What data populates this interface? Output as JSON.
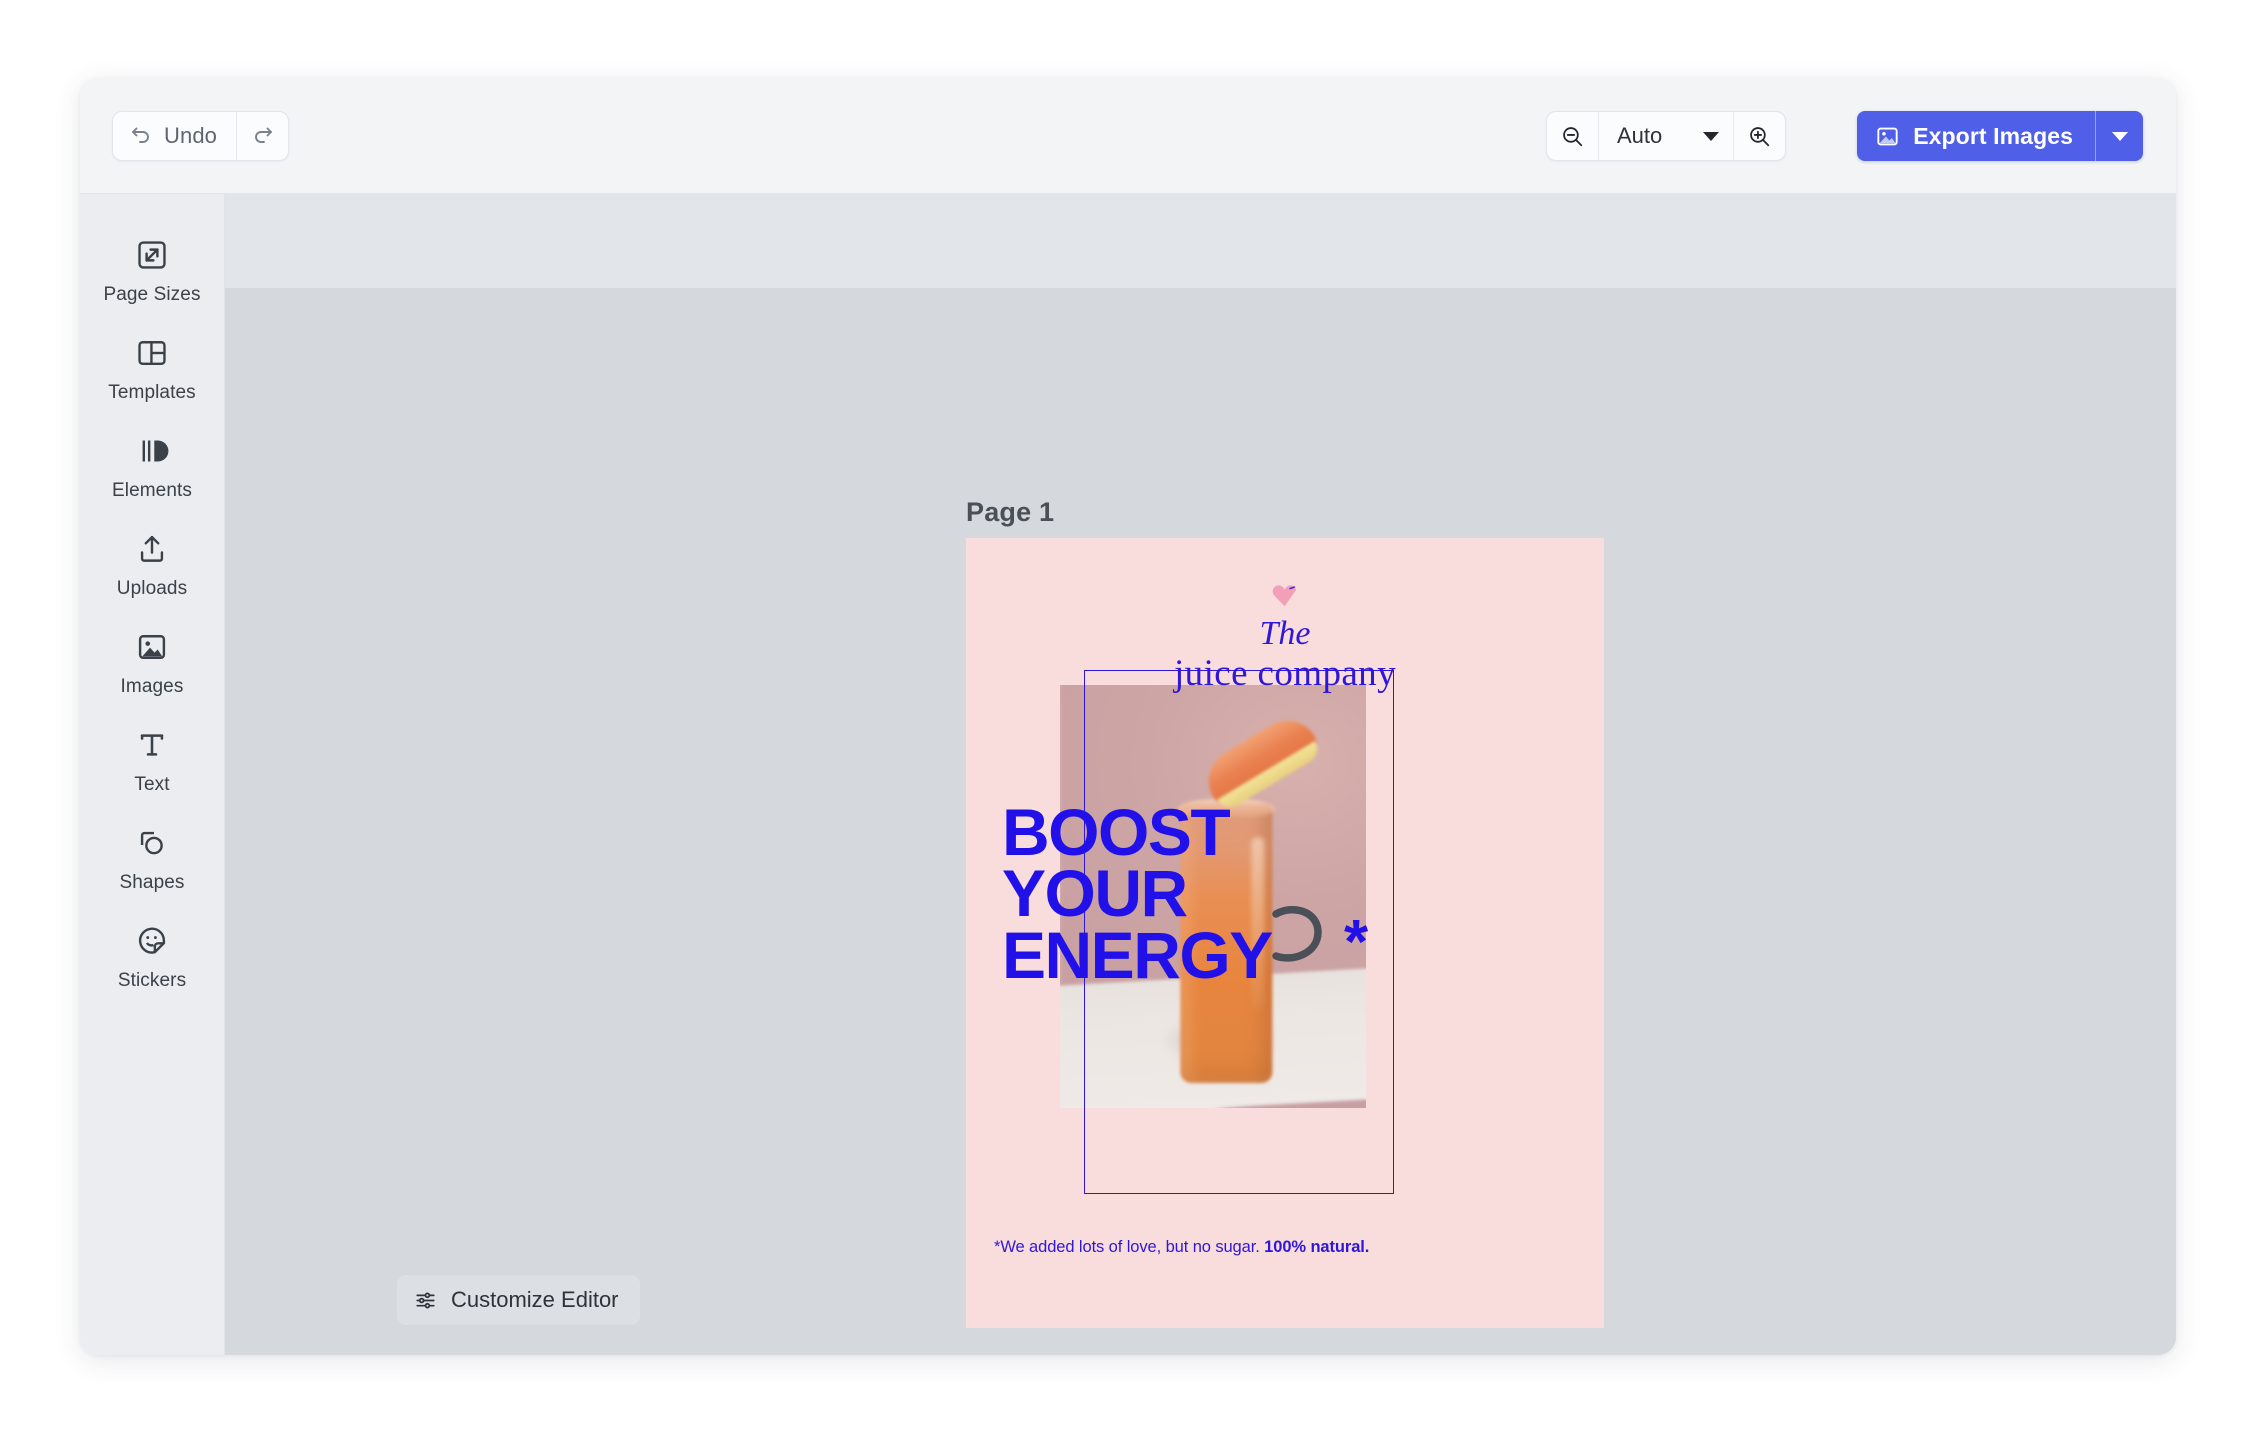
{
  "toolbar": {
    "undo_label": "Undo",
    "undo_icon": "undo-arrow-icon",
    "redo_icon": "redo-arrow-icon",
    "zoom_out_icon": "magnifier-minus-icon",
    "zoom_in_icon": "magnifier-plus-icon",
    "zoom_value": "Auto",
    "zoom_caret_icon": "chevron-down-icon",
    "export_label": "Export Images",
    "export_icon": "image-icon",
    "export_caret_icon": "chevron-down-icon",
    "export_color": "#4f5fe8"
  },
  "sidebar": {
    "items": [
      {
        "label": "Page Sizes",
        "icon": "page-sizes-icon"
      },
      {
        "label": "Templates",
        "icon": "templates-icon"
      },
      {
        "label": "Elements",
        "icon": "elements-icon"
      },
      {
        "label": "Uploads",
        "icon": "upload-icon"
      },
      {
        "label": "Images",
        "icon": "image-icon"
      },
      {
        "label": "Text",
        "icon": "text-icon"
      },
      {
        "label": "Shapes",
        "icon": "shapes-icon"
      },
      {
        "label": "Stickers",
        "icon": "sticker-smiley-icon"
      }
    ]
  },
  "workspace": {
    "page_label": "Page 1",
    "canvas_background": "#d5d8dc",
    "strip_background": "#e2e5e9"
  },
  "design": {
    "background_color": "#f9dcdc",
    "accent_color": "#2f17d9",
    "heart_icon": "heart-icon",
    "brand_the": "The",
    "brand_name": "juice company",
    "headline": "BOOST\nYOUR\nENERGY",
    "headline_asterisk": "*",
    "swoosh_icon": "swoosh-arc-icon",
    "photo_alt": "juice-glass-photo",
    "footnote_text": "*We added lots of love, but no sugar. ",
    "footnote_strong": "100% natural."
  },
  "footer": {
    "customize_label": "Customize Editor",
    "customize_icon": "sliders-icon"
  }
}
